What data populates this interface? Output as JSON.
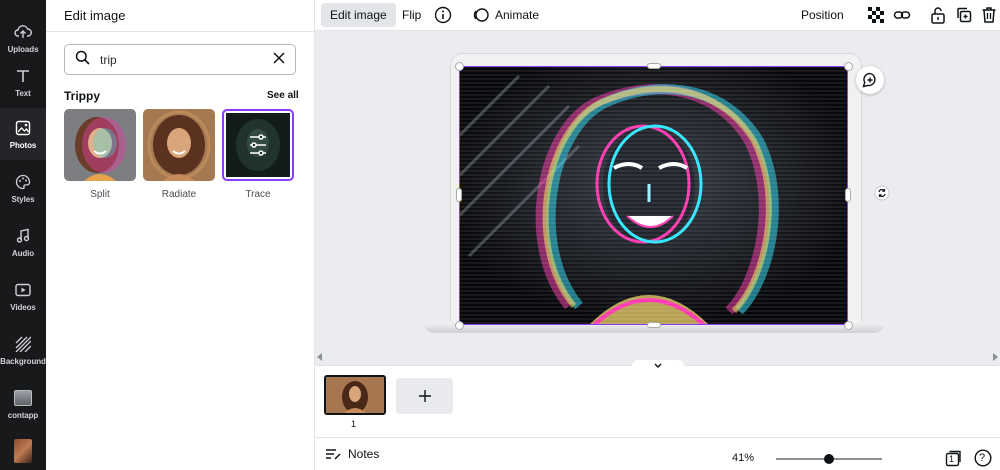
{
  "rail": {
    "items": [
      {
        "label": "Uploads",
        "icon": "upload-cloud-icon"
      },
      {
        "label": "Text",
        "icon": "text-t-icon"
      },
      {
        "label": "Photos",
        "icon": "photo-icon",
        "active": true
      },
      {
        "label": "Styles",
        "icon": "palette-icon"
      },
      {
        "label": "Audio",
        "icon": "music-note-icon"
      },
      {
        "label": "Videos",
        "icon": "video-play-icon"
      },
      {
        "label": "Background",
        "icon": "hatch-background-icon"
      },
      {
        "label": "contapp",
        "icon": "app-thumbnail-icon"
      }
    ]
  },
  "panel": {
    "title": "Edit image",
    "search": {
      "value": "trip"
    },
    "section": {
      "title": "Trippy",
      "see_all": "See all"
    },
    "effects": [
      {
        "label": "Split"
      },
      {
        "label": "Radiate"
      },
      {
        "label": "Trace",
        "selected": true
      }
    ]
  },
  "toolbar": {
    "edit_image": "Edit image",
    "flip": "Flip",
    "animate": "Animate",
    "position": "Position"
  },
  "pages": {
    "page_number": "1"
  },
  "footer": {
    "notes": "Notes",
    "zoom": "41%",
    "zoom_fraction": 0.5,
    "page_count": "1",
    "help": "?"
  },
  "colors": {
    "accent": "#8b3dff",
    "rail_bg": "#18191b",
    "canvas_bg": "#ebecf0"
  }
}
